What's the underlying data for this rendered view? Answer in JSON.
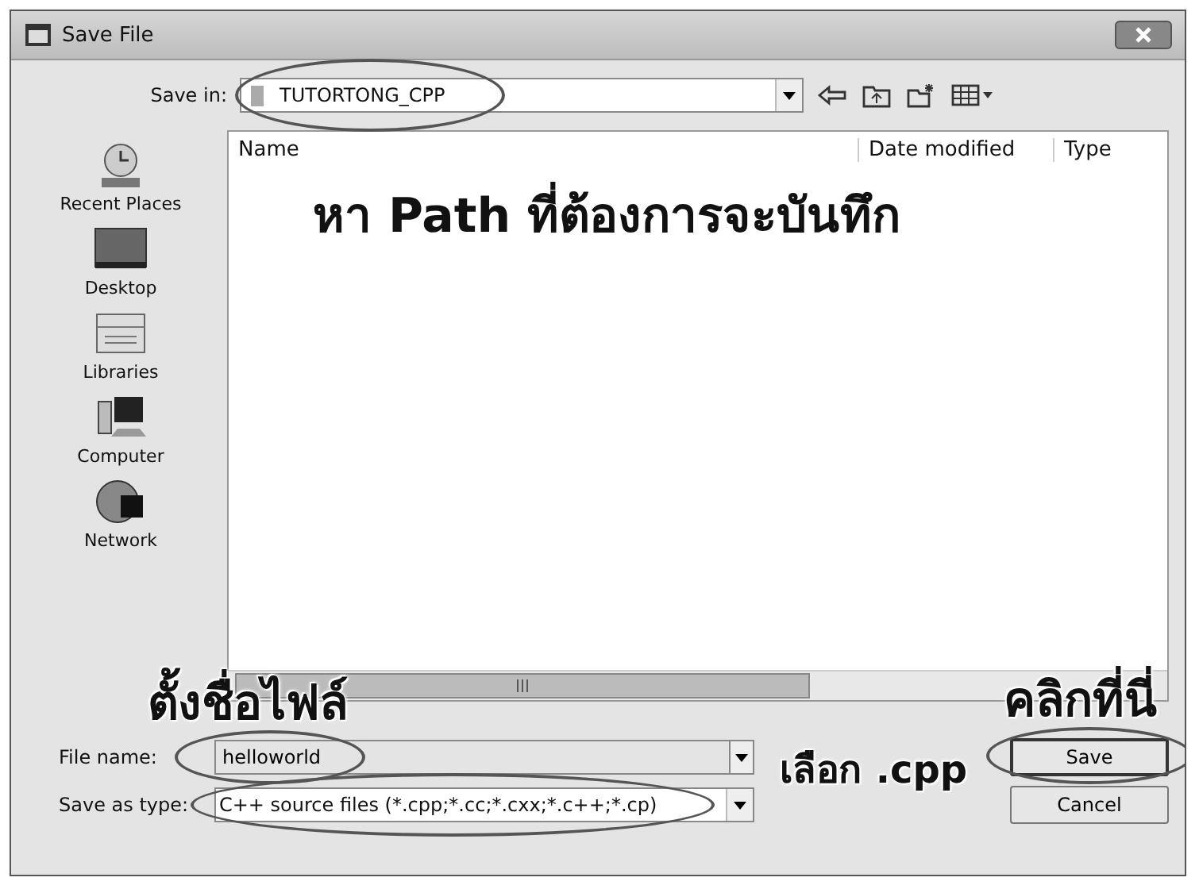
{
  "window": {
    "title": "Save File"
  },
  "save_in": {
    "label": "Save in:",
    "value": "TUTORTONG_CPP"
  },
  "places": [
    {
      "label": "Recent Places",
      "kind": "recent"
    },
    {
      "label": "Desktop",
      "kind": "desktop"
    },
    {
      "label": "Libraries",
      "kind": "libraries"
    },
    {
      "label": "Computer",
      "kind": "computer"
    },
    {
      "label": "Network",
      "kind": "network"
    }
  ],
  "file_list": {
    "columns": [
      "Name",
      "Date modified",
      "Type"
    ]
  },
  "file_name": {
    "label": "File name:",
    "value": "helloworld"
  },
  "save_as_type": {
    "label": "Save as type:",
    "value": "C++ source files (*.cpp;*.cc;*.cxx;*.c++;*.cp)"
  },
  "buttons": [
    {
      "label": "Save",
      "kind": "save"
    },
    {
      "label": "Cancel",
      "kind": "cancel"
    }
  ],
  "annotations": [
    {
      "text": "หา Path ที่ต้องการจะบันทึก"
    },
    {
      "text": "ตั้งชื่อไฟล์"
    },
    {
      "text": "เลือก .cpp"
    },
    {
      "text": "คลิกที่นี่"
    }
  ]
}
